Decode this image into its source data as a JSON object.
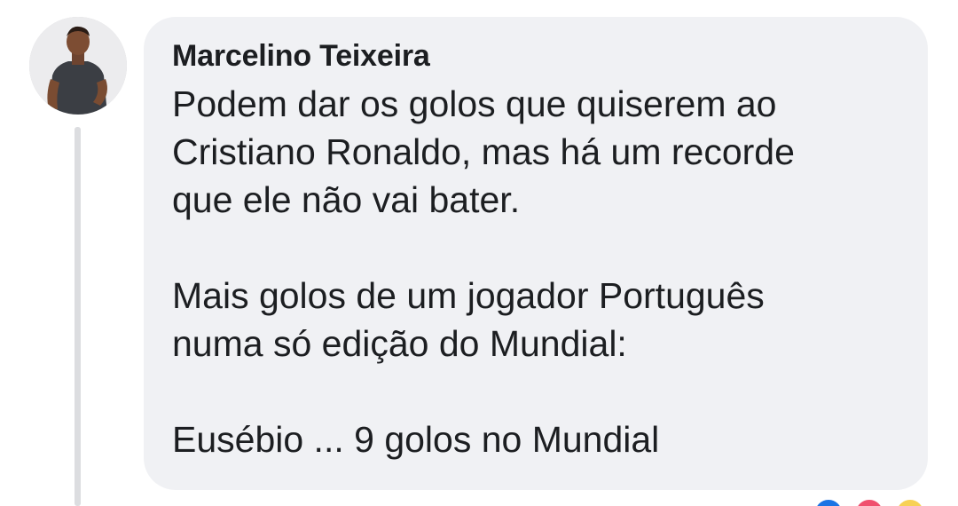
{
  "comment": {
    "author": "Marcelino Teixeira",
    "paragraphs": [
      [
        "Podem dar os golos que quiserem ao",
        "Cristiano Ronaldo, mas há um recorde",
        "que ele não vai bater."
      ],
      [
        "Mais golos de um jogador Português",
        "numa só edição do Mundial:"
      ],
      [
        "Eusébio ... 9 golos no Mundial"
      ]
    ]
  },
  "reactions": [
    {
      "icon": "like-reaction-icon",
      "color": "#1b74e4"
    },
    {
      "icon": "love-reaction-icon",
      "color": "#f0506e"
    },
    {
      "icon": "haha-reaction-icon",
      "color": "#f7d155"
    }
  ],
  "colors": {
    "bubble": "#f0f1f4",
    "text": "#1c1e21",
    "thread_line": "#dcdde0"
  }
}
